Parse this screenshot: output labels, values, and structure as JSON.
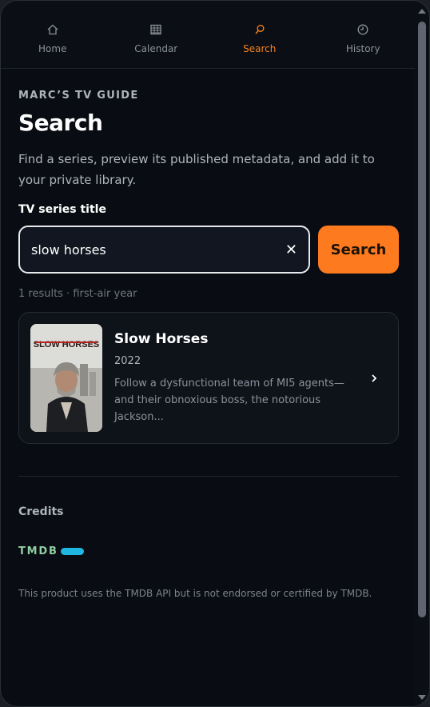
{
  "nav": {
    "items": [
      {
        "label": "Home",
        "icon": "home-icon",
        "glyph": "⌂",
        "active": false
      },
      {
        "label": "Calendar",
        "icon": "calendar-icon",
        "glyph": "▦",
        "active": false
      },
      {
        "label": "Search",
        "icon": "search-icon",
        "glyph": "⌕",
        "active": true
      },
      {
        "label": "History",
        "icon": "history-icon",
        "glyph": "◴",
        "active": false
      }
    ],
    "active_color": "#f58220"
  },
  "header": {
    "eyebrow": "MARC’S TV GUIDE",
    "title": "Search",
    "intro": "Find a series, preview its published metadata, and add it to your private library."
  },
  "search": {
    "label": "TV series title",
    "value": "slow horses",
    "clear_glyph": "✕",
    "button_label": "Search",
    "button_color": "#fd7a1f"
  },
  "results": {
    "meta": "1 results · first-air year",
    "items": [
      {
        "title": "Slow Horses",
        "year": "2022",
        "description": "Follow a dysfunctional team of MI5 agents—and their obnoxious boss, the notorious Jackson...",
        "poster_title": "SLOW HORSES"
      }
    ]
  },
  "credits": {
    "title": "Credits",
    "tmdb_logo_text": "TMDB",
    "disclaimer": "This product uses the TMDB API but is not endorsed or certified by TMDB."
  }
}
